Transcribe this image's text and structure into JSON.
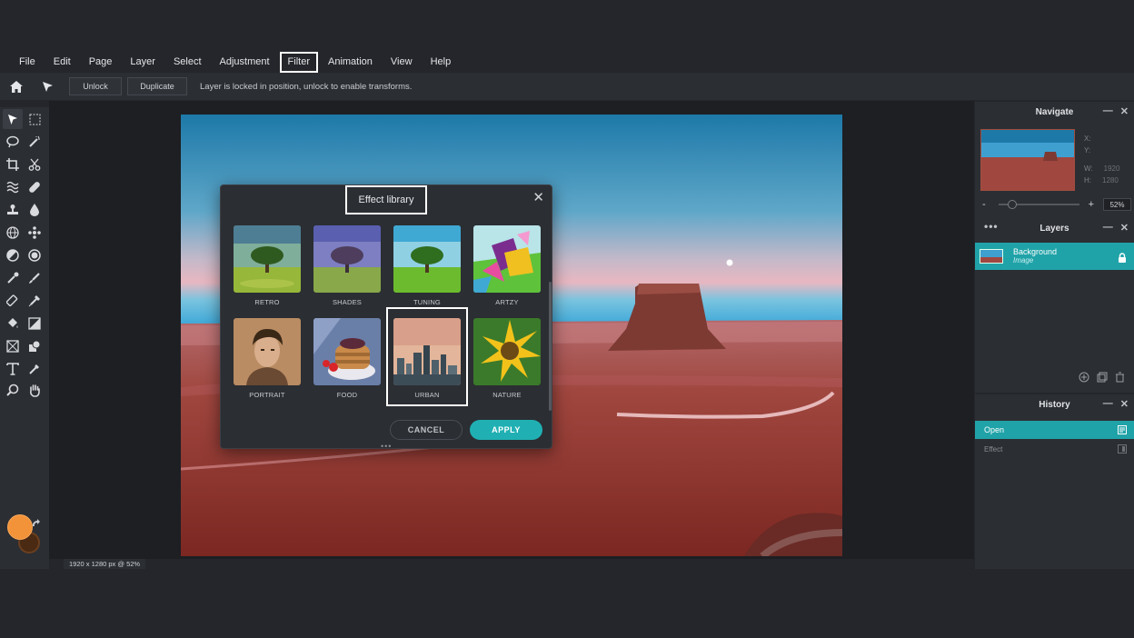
{
  "menu": [
    "File",
    "Edit",
    "Page",
    "Layer",
    "Select",
    "Adjustment",
    "Filter",
    "Animation",
    "View",
    "Help"
  ],
  "menu_highlighted": "Filter",
  "options_bar": {
    "unlock_label": "Unlock",
    "duplicate_label": "Duplicate",
    "message": "Layer is locked in position, unlock to enable transforms."
  },
  "status": {
    "info": "1920 x 1280 px @ 52%"
  },
  "navigate": {
    "title": "Navigate",
    "x_label": "X:",
    "y_label": "Y:",
    "w_label": "W:",
    "w_value": "1920",
    "h_label": "H:",
    "h_value": "1280",
    "zoom_minus": "-",
    "zoom_plus": "+",
    "zoom_value": "52%"
  },
  "layers": {
    "title": "Layers",
    "items": [
      {
        "name": "Background",
        "type": "Image"
      }
    ]
  },
  "history": {
    "title": "History",
    "items": [
      "Open",
      "Effect"
    ]
  },
  "effect_library": {
    "title": "Effect library",
    "close": "✕",
    "effects": [
      {
        "label": "RETRO"
      },
      {
        "label": "SHADES"
      },
      {
        "label": "TUNING"
      },
      {
        "label": "ARTZY"
      },
      {
        "label": "PORTRAIT"
      },
      {
        "label": "FOOD"
      },
      {
        "label": "URBAN"
      },
      {
        "label": "NATURE"
      }
    ],
    "selected": "URBAN",
    "cancel_label": "CANCEL",
    "apply_label": "APPLY"
  },
  "colors": {
    "accent": "#20a3a8",
    "foreground": "#f2933a",
    "background": "#4a2a12"
  }
}
